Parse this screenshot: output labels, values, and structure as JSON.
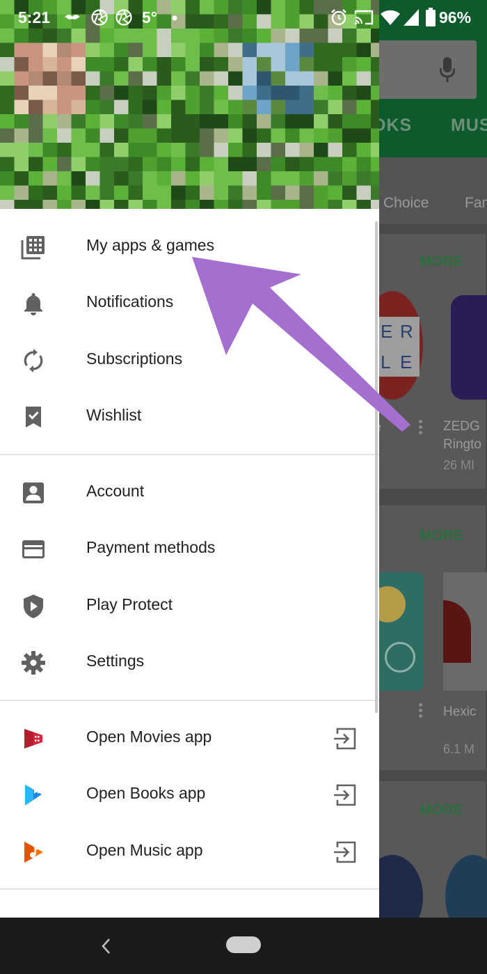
{
  "status_bar": {
    "time": "5:21",
    "temperature": "5°",
    "battery": "96%",
    "icons": [
      "mustache-icon",
      "aperture-icon",
      "aperture-icon",
      "dot-icon",
      "alarm-icon",
      "cast-icon",
      "wifi-icon",
      "signal-icon",
      "battery-icon"
    ]
  },
  "drawer": {
    "header_image": "pixelated-profile-cover",
    "sections": [
      {
        "items": [
          {
            "label": "My apps & games",
            "icon": "apps-grid-icon"
          },
          {
            "label": "Notifications",
            "icon": "bell-icon"
          },
          {
            "label": "Subscriptions",
            "icon": "refresh-icon"
          },
          {
            "label": "Wishlist",
            "icon": "bookmark-check-icon"
          }
        ]
      },
      {
        "items": [
          {
            "label": "Account",
            "icon": "account-box-icon"
          },
          {
            "label": "Payment methods",
            "icon": "credit-card-icon"
          },
          {
            "label": "Play Protect",
            "icon": "shield-icon"
          },
          {
            "label": "Settings",
            "icon": "gear-icon"
          }
        ]
      },
      {
        "items": [
          {
            "label": "Open Movies app",
            "icon": "play-movies-icon",
            "trailing_icon": "exit-to-app-icon"
          },
          {
            "label": "Open Books app",
            "icon": "play-books-icon",
            "trailing_icon": "exit-to-app-icon"
          },
          {
            "label": "Open Music app",
            "icon": "play-music-icon",
            "trailing_icon": "exit-to-app-icon"
          }
        ]
      }
    ]
  },
  "background": {
    "tabs": [
      "OKS",
      "MUS"
    ],
    "chips": [
      "Choice",
      "Fan"
    ],
    "cards": [
      {
        "more_label": "MORE",
        "app_name_line1": "ZEDG",
        "app_name_line2": "Ringto",
        "size": "26 MI",
        "left_fragment": "e"
      },
      {
        "more_label": "MORE",
        "app_name_line1": "Hexic",
        "size": "6.1 M"
      },
      {
        "more_label": "MORE"
      }
    ],
    "tile_letters": [
      "E",
      "R",
      "L",
      "E"
    ]
  },
  "colors": {
    "accent_green": "#01875f",
    "annotation_arrow": "#a56fd0",
    "header_green": "#3f7d2a"
  }
}
